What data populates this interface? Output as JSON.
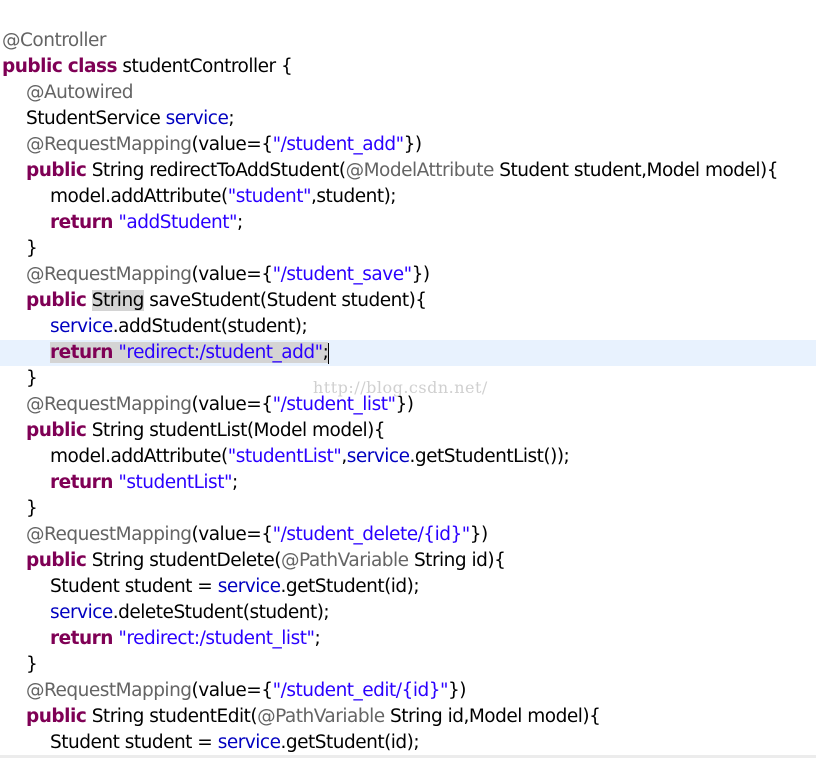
{
  "editor": {
    "watermark": "http://blog.csdn.net/",
    "lines": [
      {
        "indent": 0,
        "tokens": [
          {
            "t": "@Controller",
            "c": "ann"
          }
        ]
      },
      {
        "indent": 0,
        "tokens": [
          {
            "t": "public",
            "c": "kw"
          },
          {
            "t": " ",
            "c": "pl"
          },
          {
            "t": "class",
            "c": "kw"
          },
          {
            "t": " studentController {",
            "c": "pl"
          }
        ]
      },
      {
        "indent": 1,
        "tokens": [
          {
            "t": "@Autowired",
            "c": "ann"
          }
        ]
      },
      {
        "indent": 1,
        "tokens": [
          {
            "t": "StudentService ",
            "c": "pl"
          },
          {
            "t": "service",
            "c": "fld"
          },
          {
            "t": ";",
            "c": "pl"
          }
        ]
      },
      {
        "indent": 1,
        "tokens": [
          {
            "t": "@RequestMapping",
            "c": "ann"
          },
          {
            "t": "(value={",
            "c": "pl"
          },
          {
            "t": "\"/student_add\"",
            "c": "str"
          },
          {
            "t": "})",
            "c": "pl"
          }
        ]
      },
      {
        "indent": 1,
        "tokens": [
          {
            "t": "public",
            "c": "kw"
          },
          {
            "t": " String redirectToAddStudent(",
            "c": "pl"
          },
          {
            "t": "@ModelAttribute",
            "c": "ann"
          },
          {
            "t": " Student student,Model model){",
            "c": "pl"
          }
        ]
      },
      {
        "indent": 2,
        "tokens": [
          {
            "t": "model.addAttribute(",
            "c": "pl"
          },
          {
            "t": "\"student\"",
            "c": "str"
          },
          {
            "t": ",student);",
            "c": "pl"
          }
        ]
      },
      {
        "indent": 2,
        "tokens": [
          {
            "t": "return",
            "c": "kw"
          },
          {
            "t": " ",
            "c": "pl"
          },
          {
            "t": "\"addStudent\"",
            "c": "str"
          },
          {
            "t": ";",
            "c": "pl"
          }
        ]
      },
      {
        "indent": 1,
        "tokens": [
          {
            "t": "}",
            "c": "pl"
          }
        ]
      },
      {
        "indent": 1,
        "tokens": [
          {
            "t": "@RequestMapping",
            "c": "ann"
          },
          {
            "t": "(value={",
            "c": "pl"
          },
          {
            "t": "\"/student_save\"",
            "c": "str"
          },
          {
            "t": "})",
            "c": "pl"
          }
        ]
      },
      {
        "indent": 1,
        "tokens": [
          {
            "t": "public",
            "c": "kw"
          },
          {
            "t": " ",
            "c": "pl"
          },
          {
            "t": "String",
            "c": "pl occ"
          },
          {
            "t": " saveStudent(Student student){",
            "c": "pl"
          }
        ]
      },
      {
        "indent": 2,
        "tokens": [
          {
            "t": "service",
            "c": "fld"
          },
          {
            "t": ".addStudent(student);",
            "c": "pl"
          }
        ]
      },
      {
        "indent": 2,
        "current": true,
        "tokens": [
          {
            "t": "return",
            "c": "kw occ"
          },
          {
            "t": " ",
            "c": "pl occ"
          },
          {
            "t": "\"redirect:/student_add\"",
            "c": "str occ"
          },
          {
            "t": ";",
            "c": "pl occ"
          }
        ]
      },
      {
        "indent": 1,
        "tokens": [
          {
            "t": "}",
            "c": "pl"
          }
        ]
      },
      {
        "indent": 1,
        "tokens": [
          {
            "t": "@RequestMapping",
            "c": "ann"
          },
          {
            "t": "(value={",
            "c": "pl"
          },
          {
            "t": "\"/student_list\"",
            "c": "str"
          },
          {
            "t": "})",
            "c": "pl"
          }
        ]
      },
      {
        "indent": 1,
        "tokens": [
          {
            "t": "public",
            "c": "kw"
          },
          {
            "t": " String studentList(Model model){",
            "c": "pl"
          }
        ]
      },
      {
        "indent": 2,
        "tokens": [
          {
            "t": "model.addAttribute(",
            "c": "pl"
          },
          {
            "t": "\"studentList\"",
            "c": "str"
          },
          {
            "t": ",",
            "c": "pl"
          },
          {
            "t": "service",
            "c": "fld"
          },
          {
            "t": ".getStudentList());",
            "c": "pl"
          }
        ]
      },
      {
        "indent": 2,
        "tokens": [
          {
            "t": "return",
            "c": "kw"
          },
          {
            "t": " ",
            "c": "pl"
          },
          {
            "t": "\"studentList\"",
            "c": "str"
          },
          {
            "t": ";",
            "c": "pl"
          }
        ]
      },
      {
        "indent": 1,
        "tokens": [
          {
            "t": "}",
            "c": "pl"
          }
        ]
      },
      {
        "indent": 1,
        "tokens": [
          {
            "t": "@RequestMapping",
            "c": "ann"
          },
          {
            "t": "(value={",
            "c": "pl"
          },
          {
            "t": "\"/student_delete/{id}\"",
            "c": "str"
          },
          {
            "t": "})",
            "c": "pl"
          }
        ]
      },
      {
        "indent": 1,
        "tokens": [
          {
            "t": "public",
            "c": "kw"
          },
          {
            "t": " String studentDelete(",
            "c": "pl"
          },
          {
            "t": "@PathVariable",
            "c": "ann"
          },
          {
            "t": " String id){",
            "c": "pl"
          }
        ]
      },
      {
        "indent": 2,
        "tokens": [
          {
            "t": "Student student = ",
            "c": "pl"
          },
          {
            "t": "service",
            "c": "fld"
          },
          {
            "t": ".getStudent(id);",
            "c": "pl"
          }
        ]
      },
      {
        "indent": 2,
        "tokens": [
          {
            "t": "service",
            "c": "fld"
          },
          {
            "t": ".deleteStudent(student);",
            "c": "pl"
          }
        ]
      },
      {
        "indent": 2,
        "tokens": [
          {
            "t": "return",
            "c": "kw"
          },
          {
            "t": " ",
            "c": "pl"
          },
          {
            "t": "\"redirect:/student_list\"",
            "c": "str"
          },
          {
            "t": ";",
            "c": "pl"
          }
        ]
      },
      {
        "indent": 1,
        "tokens": [
          {
            "t": "}",
            "c": "pl"
          }
        ]
      },
      {
        "indent": 1,
        "tokens": [
          {
            "t": "@RequestMapping",
            "c": "ann"
          },
          {
            "t": "(value={",
            "c": "pl"
          },
          {
            "t": "\"/student_edit/{id}\"",
            "c": "str"
          },
          {
            "t": "})",
            "c": "pl"
          }
        ]
      },
      {
        "indent": 1,
        "tokens": [
          {
            "t": "public",
            "c": "kw"
          },
          {
            "t": " String studentEdit(",
            "c": "pl"
          },
          {
            "t": "@PathVariable",
            "c": "ann"
          },
          {
            "t": " String id,Model model){",
            "c": "pl"
          }
        ]
      },
      {
        "indent": 2,
        "tokens": [
          {
            "t": "Student student = ",
            "c": "pl"
          },
          {
            "t": "service",
            "c": "fld"
          },
          {
            "t": ".getStudent(id);",
            "c": "pl"
          }
        ]
      }
    ]
  }
}
